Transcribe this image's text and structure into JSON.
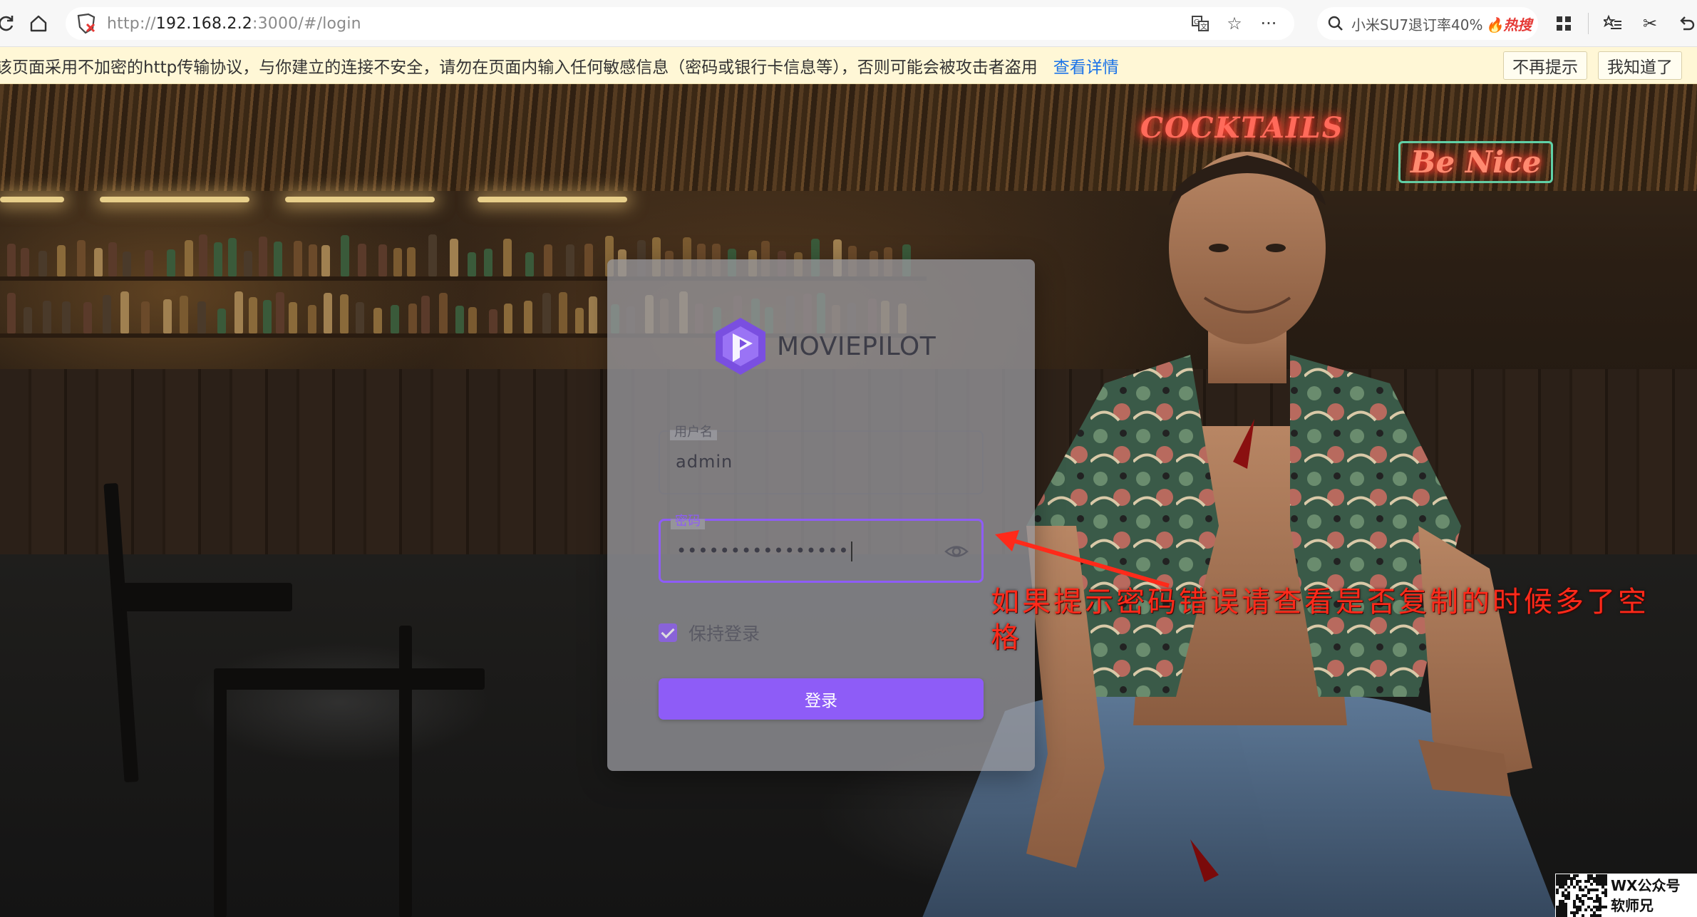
{
  "browser": {
    "url_prefix": "http://",
    "url_host": "192.168.2.2",
    "url_rest": ":3000/#/login",
    "search_query": "小米SU7退订率40%",
    "search_hot_badge": "热搜"
  },
  "warning_bar": {
    "message": "该页面采用不加密的http传输协议，与你建立的连接不安全，请勿在页面内输入任何敏感信息（密码或银行卡信息等），否则可能会被攻击者盗用",
    "details_link": "查看详情",
    "dont_remind_button": "不再提示",
    "got_it_button": "我知道了"
  },
  "scene_signs": {
    "cocktails": "COCKTAILS",
    "be_nice": "Be Nice"
  },
  "login": {
    "brand_name": "MOVIEPILOT",
    "username_label": "用户名",
    "username_value": "admin",
    "password_label": "密码",
    "password_value": "••••••••••••••••",
    "remember_label": "保持登录",
    "remember_checked": true,
    "login_button": "登录",
    "accent_color": "#8e5cf7"
  },
  "annotation": {
    "text": "如果提示密码错误请查看是否复制的时候多了空格",
    "color": "#ff2a1a"
  },
  "watermark": {
    "line1": "WX公众号",
    "line2": "软师兄"
  }
}
